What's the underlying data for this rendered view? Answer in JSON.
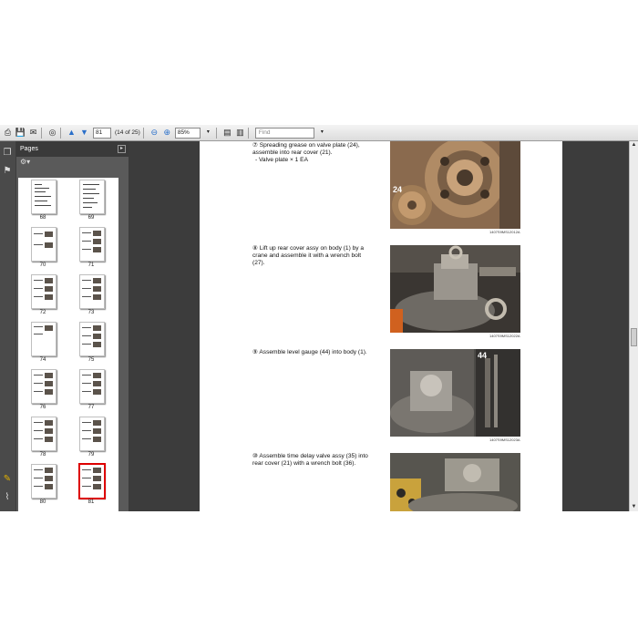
{
  "toolbar": {
    "page_number": "81",
    "page_of": "(14 of 25)",
    "zoom": "85%",
    "find_placeholder": "Find"
  },
  "pages_panel": {
    "title": "Pages",
    "thumbnails": [
      {
        "label": "68"
      },
      {
        "label": "69"
      },
      {
        "label": "70"
      },
      {
        "label": "71"
      },
      {
        "label": "72"
      },
      {
        "label": "73"
      },
      {
        "label": "74"
      },
      {
        "label": "75"
      },
      {
        "label": "76"
      },
      {
        "label": "77"
      },
      {
        "label": "78"
      },
      {
        "label": "79"
      },
      {
        "label": "80"
      },
      {
        "label": "81"
      }
    ],
    "selected": "81"
  },
  "document": {
    "steps": [
      {
        "text": "⑦ Spreading grease on valve plate (24), assemble into rear cover (21).",
        "sub": "- Valve plate × 1 EA",
        "caption": "1407S9MS12012A",
        "photo_label": "24"
      },
      {
        "text": "⑧ Lift up rear cover assy on body (1) by a crane and assemble it with a wrench bolt (27).",
        "sub": "",
        "caption": "1407S9MS12022A",
        "photo_label": ""
      },
      {
        "text": "⑨ Assemble level gauge (44) into body (1).",
        "sub": "",
        "caption": "1407S9MS12023A",
        "photo_label": "44"
      },
      {
        "text": "⑩ Assemble time delay valve assy (35) into rear cover (21) with a wrench bolt (36).",
        "sub": "",
        "caption": "",
        "photo_label": ""
      }
    ]
  },
  "colors": {
    "app_background": "#3c3c3c",
    "selected_thumbnail": "#dd0000",
    "page": "#ffffff"
  }
}
